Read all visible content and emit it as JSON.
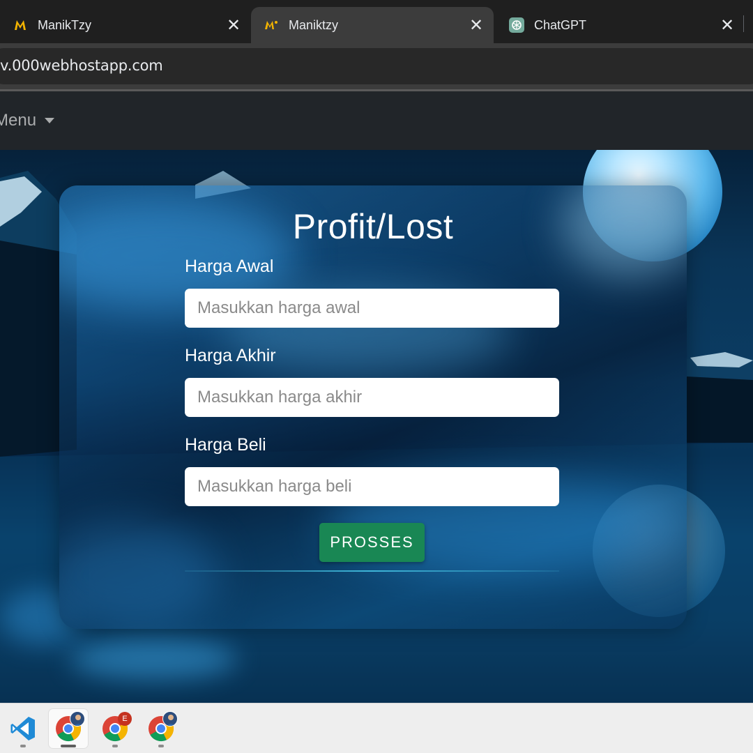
{
  "browser": {
    "tabs": [
      {
        "title": "ManikTzy",
        "favicon": "manik-logo-icon",
        "active": false
      },
      {
        "title": "Maniktzy",
        "favicon": "manik-logo-icon",
        "active": true
      },
      {
        "title": "ChatGPT",
        "favicon": "chatgpt-icon",
        "active": false
      }
    ],
    "close_glyph": "✕",
    "url": "v.000webhostapp.com"
  },
  "navbar": {
    "menu_label": "Menu"
  },
  "form": {
    "title": "Profit/Lost",
    "fields": [
      {
        "label": "Harga Awal",
        "placeholder": "Masukkan harga awal",
        "value": ""
      },
      {
        "label": "Harga Akhir",
        "placeholder": "Masukkan harga akhir",
        "value": ""
      },
      {
        "label": "Harga Beli",
        "placeholder": "Masukkan harga beli",
        "value": ""
      }
    ],
    "submit_label": "PROSSES"
  },
  "taskbar": {
    "items": [
      {
        "name": "vscode-icon",
        "badge": ""
      },
      {
        "name": "chrome-icon",
        "badge": "profile"
      },
      {
        "name": "chrome-icon",
        "badge": "E"
      },
      {
        "name": "chrome-icon",
        "badge": "profile"
      }
    ]
  },
  "colors": {
    "submit_button": "#198754",
    "navbar": "#212529",
    "accent_line": "#3fb7d9"
  }
}
